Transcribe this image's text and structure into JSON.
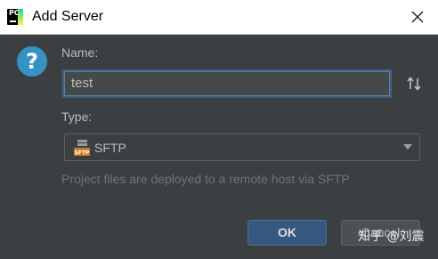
{
  "window": {
    "title": "Add Server",
    "app_icon_text": "PC"
  },
  "form": {
    "name_label": "Name:",
    "name_value": "test",
    "type_label": "Type:",
    "type_value": "SFTP",
    "type_icon_text": "SFTP",
    "description": "Project files are deployed to a remote host via SFTP"
  },
  "buttons": {
    "ok": "OK",
    "cancel": "Cancel"
  },
  "watermark": "知乎 @刘震",
  "colors": {
    "background": "#3c3f41",
    "accent": "#3592c4",
    "ok_button": "#365880",
    "focus_border": "#3d6185"
  },
  "icons": {
    "help": "question-mark-icon",
    "sort": "sort-arrows-icon",
    "close": "close-icon",
    "sftp": "sftp-server-icon",
    "dropdown": "chevron-down-icon"
  }
}
